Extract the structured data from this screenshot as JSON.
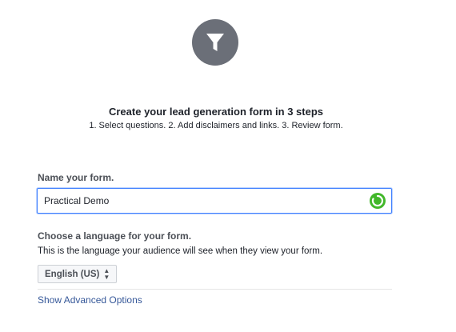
{
  "header": {
    "icon": "funnel-icon",
    "title": "Create your lead generation form in 3 steps",
    "subtitle": "1. Select questions. 2. Add disclaimers and links. 3. Review form."
  },
  "name_section": {
    "label": "Name your form.",
    "value": "Practical Demo",
    "status_icon": "loading-spinner-icon"
  },
  "language_section": {
    "label": "Choose a language for your form.",
    "description": "This is the language your audience will see when they view your form.",
    "selected": "English (US)"
  },
  "advanced_link": "Show Advanced Options",
  "colors": {
    "icon_circle": "#6b6f78",
    "focus_border": "#4080ff",
    "spinner": "#42b72a",
    "link": "#365899"
  }
}
